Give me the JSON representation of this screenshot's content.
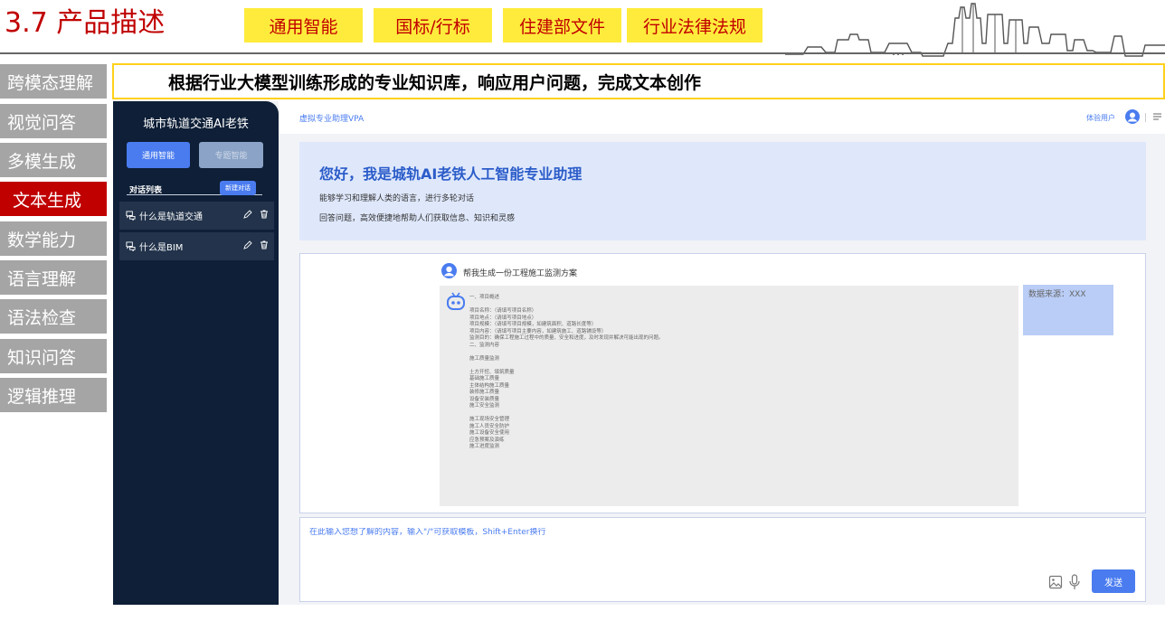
{
  "slide": {
    "title": "3.7 产品描述",
    "tags": [
      "通用智能",
      "国标/行标",
      "住建部文件",
      "行业法律法规"
    ],
    "banner": "根据行业大模型训练形成的专业知识库，响应用户问题，完成文本创作",
    "colors": {
      "title": "#c00000",
      "tag_bg": "#ffeb3b",
      "nav_bg": "#a5a5a5",
      "nav_active": "#c00000"
    }
  },
  "nav": {
    "items": [
      "跨模态理解",
      "视觉问答",
      "多模生成",
      "文本生成",
      "数学能力",
      "语言理解",
      "语法检查",
      "知识问答",
      "逻辑推理"
    ],
    "active": "文本生成"
  },
  "app": {
    "sidebar": {
      "title": "城市轨道交通AI老铁",
      "mode_general": "通用智能",
      "mode_pro": "专题智能",
      "conv_list_label": "对话列表",
      "new_conv": "新建对话",
      "conversations": [
        "什么是轨道交通",
        "什么是BIM"
      ]
    },
    "topbar": {
      "app_name": "虚拟专业助理VPA",
      "user": "体验用户"
    },
    "welcome": {
      "title": "您好，我是城轨AI老铁人工智能专业助理",
      "line1": "能够学习和理解人类的语言，进行多轮对话",
      "line2": "回答问题，高效便捷地帮助人们获取信息、知识和灵感"
    },
    "chat": {
      "question": "帮我生成一份工程施工监测方案",
      "answer_lines": [
        "一、项目概述",
        "",
        "项目名称：（请填写项目名称）",
        "项目地点：（请填写项目地点）",
        "项目规模：（请填写项目规模，如建筑面积、道路长度等）",
        "项目内容：（请填写项目主要内容，如建筑施工、道路铺设等）",
        "监测目的：确保工程施工过程中的质量、安全和进度，及时发现并解决可能出现的问题。",
        "二、监测内容",
        "",
        "施工质量监测",
        "",
        "土方开挖、填筑质量",
        "基础施工质量",
        "主体结构施工质量",
        "装修施工质量",
        "设备安装质量",
        "施工安全监测",
        "",
        "施工现场安全管理",
        "施工人员安全防护",
        "施工设备安全使用",
        "应急预案及演练",
        "施工进度监测"
      ],
      "source": "数据来源：XXX"
    },
    "input": {
      "placeholder": "在此输入您想了解的内容，输入\"/\"可获取模板，Shift+Enter换行",
      "send": "发送"
    },
    "colors": {
      "sidebar": "#0e1f37",
      "accent": "#4a7cf0",
      "welcome_bg": "#dfe8fb",
      "source_bg": "#b9cdf6"
    }
  }
}
